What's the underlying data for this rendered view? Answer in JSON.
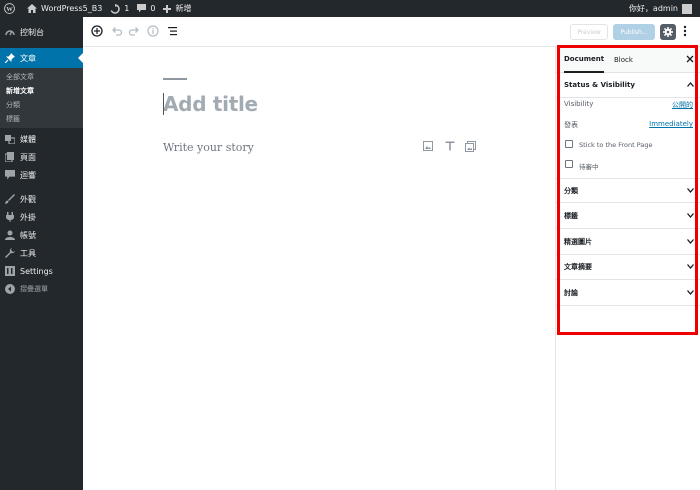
{
  "admin_bar": {
    "site_name": "WordPress5_B3",
    "updates_count": "1",
    "comments_count": "0",
    "new_label": "新增",
    "greeting": "你好，admin"
  },
  "sidebar": {
    "dashboard": "控制台",
    "posts": "文章",
    "posts_submenu": [
      "全部文章",
      "新增文章",
      "分類",
      "標籤"
    ],
    "media": "媒體",
    "pages": "頁面",
    "comments": "迴響",
    "appearance": "外觀",
    "plugins": "外掛",
    "users": "帳號",
    "tools": "工具",
    "settings": "Settings",
    "collapse": "摺疊選單"
  },
  "toolbar": {
    "preview_label": "Preview",
    "publish_label": "Publish..."
  },
  "editor": {
    "title_placeholder": "Add title",
    "body_placeholder": "Write your story"
  },
  "settings_panel": {
    "tab_document": "Document",
    "tab_block": "Block",
    "status_visibility": {
      "heading": "Status & Visibility",
      "visibility_label": "Visibility",
      "visibility_value": "公開的",
      "publish_label": "發表",
      "publish_value": "Immediately",
      "stick_label": "Stick to the Front Page",
      "pending_label": "待審中",
      "stick_checked": false,
      "pending_checked": false
    },
    "panels": [
      "分類",
      "標籤",
      "精選圖片",
      "文章摘要",
      "討論"
    ]
  },
  "colors": {
    "admin_dark": "#23282d",
    "accent_blue": "#0073aa",
    "highlight_red": "#e00000"
  }
}
